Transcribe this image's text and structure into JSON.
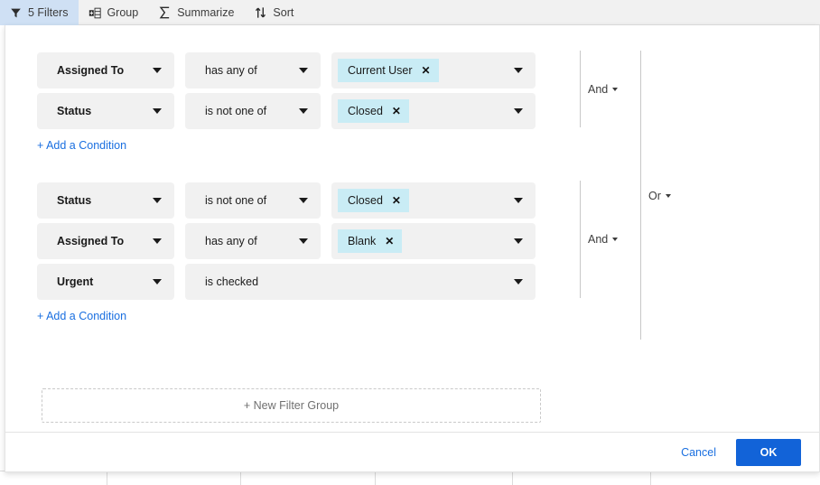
{
  "toolbar": {
    "items": [
      {
        "label": "5 Filters",
        "icon": "funnel-icon",
        "active": true
      },
      {
        "label": "Group",
        "icon": "group-icon",
        "active": false
      },
      {
        "label": "Summarize",
        "icon": "sigma-icon",
        "active": false
      },
      {
        "label": "Sort",
        "icon": "sort-arrows-icon",
        "active": false
      }
    ]
  },
  "dialog": {
    "groups": [
      {
        "id": "group-1",
        "conditions": [
          {
            "attribute": "Assigned To",
            "operator": "has any of",
            "chip": "Current User",
            "remove_label": "✕",
            "has_value_field": true
          },
          {
            "attribute": "Status",
            "operator": "is not one of",
            "chip": "Closed",
            "remove_label": "✕",
            "has_value_field": true
          }
        ],
        "add_condition_label": "+ Add a Condition",
        "connector": "And"
      },
      {
        "id": "group-2",
        "conditions": [
          {
            "attribute": "Status",
            "operator": "is not one of",
            "chip": "Closed",
            "remove_label": "✕",
            "has_value_field": true
          },
          {
            "attribute": "Assigned To",
            "operator": "has any of",
            "chip": "Blank",
            "remove_label": "✕",
            "has_value_field": true
          },
          {
            "attribute": "Urgent",
            "operator": "is checked",
            "chip": null,
            "remove_label": null,
            "has_value_field": false
          }
        ],
        "add_condition_label": "+ Add a Condition",
        "connector": "And"
      }
    ],
    "outer_connector": "Or",
    "new_filter_group_label": "+ New Filter Group"
  },
  "footer": {
    "cancel_label": "Cancel",
    "ok_label": "OK"
  },
  "colors": {
    "accent_blue": "#1263d8",
    "link_blue": "#1a6fe0",
    "chip_bg": "#c9ecf5",
    "field_bg": "#f1f1f1",
    "toolbar_bg": "#f1f1f1",
    "toolbar_active_bg": "#cfe0f4"
  }
}
